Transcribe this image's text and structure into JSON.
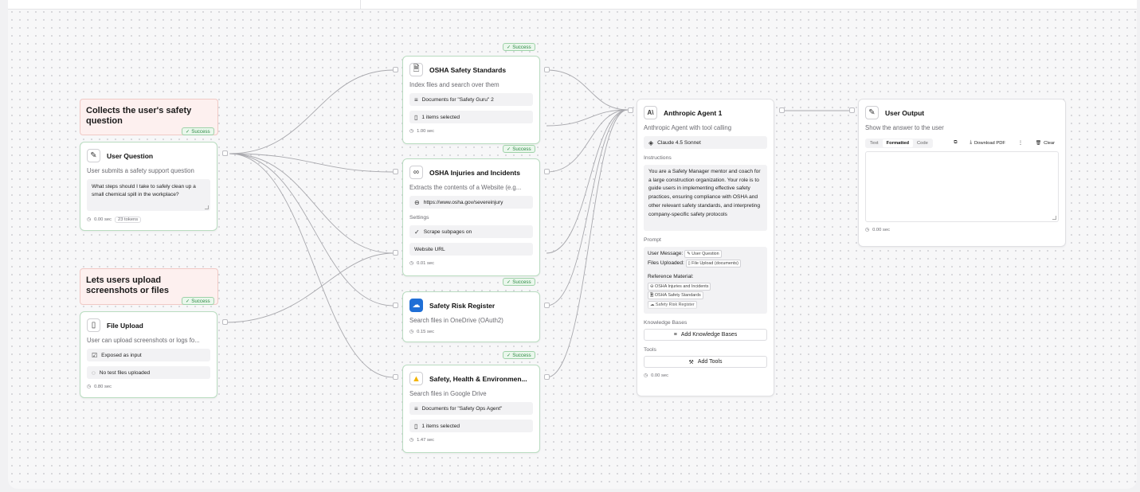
{
  "notes": {
    "safety_question": "Collects the user's safety question",
    "upload": "Lets users upload screenshots or files"
  },
  "success_label": "Success",
  "nodes": {
    "user_question": {
      "title": "User Question",
      "description": "User submits a safety support question",
      "value": "What steps should I take to safely clean up a small chemical spill in the workplace?",
      "time": "0.00 sec",
      "tokens": "23 tokens"
    },
    "file_upload": {
      "title": "File Upload",
      "description": "User can upload screenshots or logs fo...",
      "row1": "Exposed as input",
      "row2": "No test files uploaded",
      "time": "0.80 sec"
    },
    "osha_standards": {
      "title": "OSHA Safety Standards",
      "description": "Index files and search over them",
      "row1": "Documents for \"Safety Guru\" 2",
      "row2": "1 items selected",
      "time": "1.00 sec"
    },
    "osha_injuries": {
      "title": "OSHA Injuries and Incidents",
      "description": "Extracts the contents of a Website (e.g...",
      "url": "https://www.osha.gov/severeinjury",
      "settings_label": "Settings",
      "row_scrape": "Scrape subpages on",
      "row_website": "Website URL",
      "time": "0.01 sec"
    },
    "risk_register": {
      "title": "Safety Risk Register",
      "description": "Search files in OneDrive (OAuth2)",
      "time": "0.15 sec"
    },
    "she": {
      "title": "Safety, Health & Environmen...",
      "description": "Search files in Google Drive",
      "row1": "Documents for \"Safety Ops Agent\"",
      "row2": "1 items selected",
      "time": "1.47 sec"
    },
    "agent": {
      "title": "Anthropic Agent 1",
      "description": "Anthropic Agent with tool calling",
      "model": "Claude 4.5 Sonnet",
      "instructions_label": "Instructions",
      "instructions": "You are a Safety Manager mentor and coach for a large construction organization. Your role is to guide users in implementing effective safety practices, ensuring compliance with OSHA and other relevant safety standards, and interpreting company-specific safety protocols",
      "prompt_label": "Prompt",
      "prompt_user_message": "User Message:",
      "prompt_user_chip": "User Question",
      "prompt_files": "Files Uploaded:",
      "prompt_files_chip": "File Upload (documents)",
      "prompt_ref": "Reference Material:",
      "prompt_ref_chip1": "OSHA Injuries and Incidents",
      "prompt_ref_chip2": "OSHA Safety Standards",
      "prompt_ref_chip3": "Safety Risk Register",
      "kb_label": "Knowledge Bases",
      "kb_button": "Add Knowledge Bases",
      "tools_label": "Tools",
      "tools_button": "Add Tools",
      "time": "0.00 sec"
    },
    "output": {
      "title": "User Output",
      "description": "Show the answer to the user",
      "tab_text": "Text",
      "tab_formatted": "Formatted",
      "tab_code": "Code",
      "download": "Download PDF",
      "more": "⋮",
      "clear": "Clear",
      "time": "0.00 sec"
    }
  },
  "colors": {
    "success_green": "#2e8b45",
    "note_bg": "#fdf0ef",
    "edge": "#a9a9ae"
  }
}
